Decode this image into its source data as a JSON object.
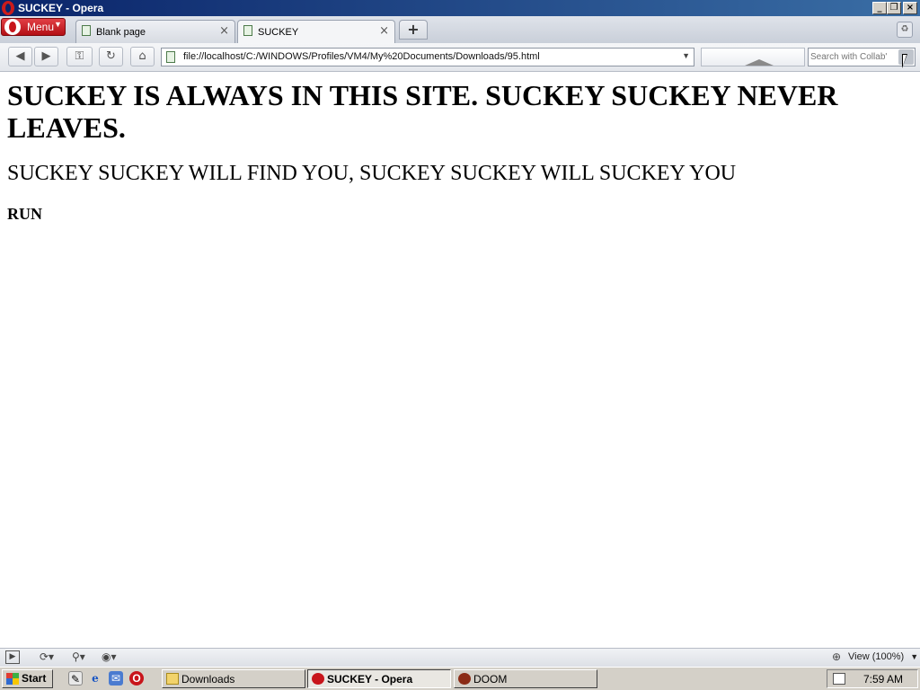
{
  "window": {
    "title": "SUCKEY - Opera"
  },
  "menu": {
    "label": "Menu"
  },
  "tabs": [
    {
      "title": "Blank page",
      "active": false
    },
    {
      "title": "SUCKEY",
      "active": true
    }
  ],
  "toolbar": {
    "url": "file://localhost/C:/WINDOWS/Profiles/VM4/My%20Documents/Downloads/95.html",
    "search_placeholder": "Search with Collab'"
  },
  "page": {
    "heading1": "SUCKEY IS ALWAYS IN THIS SITE. SUCKEY SUCKEY NEVER LEAVES.",
    "heading2": "SUCKEY SUCKEY WILL FIND YOU, SUCKEY SUCKEY WILL SUCKEY YOU",
    "heading3": "RUN"
  },
  "statusbar": {
    "zoom_label": "View (100%)"
  },
  "taskbar": {
    "start_label": "Start",
    "tasks": [
      {
        "label": "Downloads",
        "icon": "folder-icon",
        "active": false
      },
      {
        "label": "SUCKEY - Opera",
        "icon": "opera-icon",
        "active": true
      },
      {
        "label": "DOOM",
        "icon": "doom-icon",
        "active": false
      }
    ],
    "clock": "7:59 AM"
  },
  "colors": {
    "titlebar": "#0a246a",
    "opera_red": "#c8151b",
    "taskbar": "#d4d0c8"
  }
}
